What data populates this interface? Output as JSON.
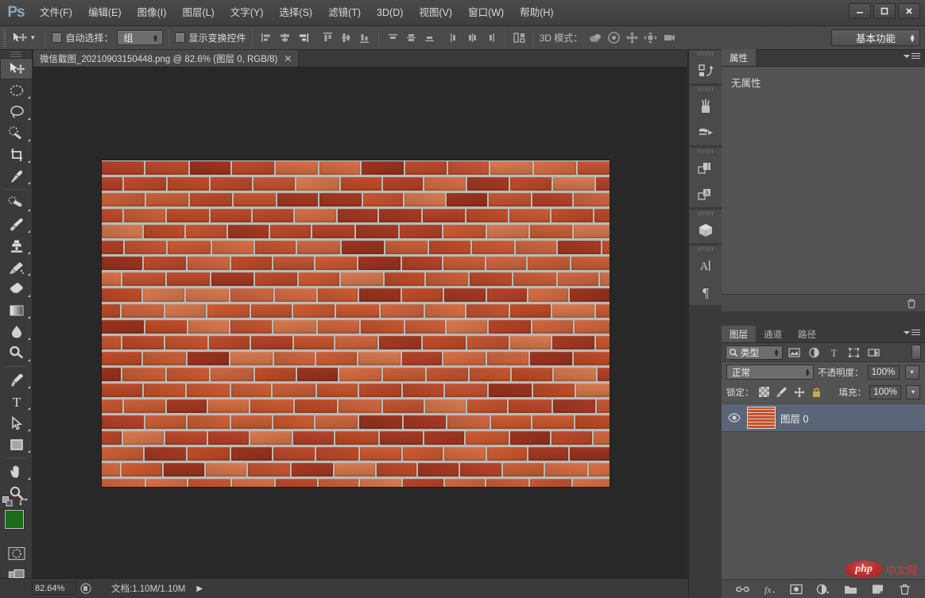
{
  "app": {
    "logo": "Ps",
    "window_controls": {
      "minimize": "—",
      "maximize": "▢",
      "close": "✕"
    }
  },
  "menubar": {
    "items": [
      {
        "label": "文件(F)",
        "name": "menu-file"
      },
      {
        "label": "编辑(E)",
        "name": "menu-edit"
      },
      {
        "label": "图像(I)",
        "name": "menu-image"
      },
      {
        "label": "图层(L)",
        "name": "menu-layer"
      },
      {
        "label": "文字(Y)",
        "name": "menu-type"
      },
      {
        "label": "选择(S)",
        "name": "menu-select"
      },
      {
        "label": "滤镜(T)",
        "name": "menu-filter"
      },
      {
        "label": "3D(D)",
        "name": "menu-3d"
      },
      {
        "label": "视图(V)",
        "name": "menu-view"
      },
      {
        "label": "窗口(W)",
        "name": "menu-window"
      },
      {
        "label": "帮助(H)",
        "name": "menu-help"
      }
    ]
  },
  "options_bar": {
    "auto_select_label": "自动选择：",
    "auto_select_value": "组",
    "show_transform_label": "显示变换控件",
    "mode_3d_label": "3D 模式：",
    "workspace": "基本功能"
  },
  "document_tab": {
    "title": "微信截图_20210903150448.png @ 82.6% (图层 0, RGB/8)",
    "close": "✕"
  },
  "toolbar": {
    "tools": [
      {
        "name": "move-tool",
        "label": "移动工具"
      },
      {
        "name": "marquee-tool",
        "label": "矩形选框工具"
      },
      {
        "name": "lasso-tool",
        "label": "套索工具"
      },
      {
        "name": "quick-selection-tool",
        "label": "快速选择工具"
      },
      {
        "name": "crop-tool",
        "label": "裁剪工具"
      },
      {
        "name": "eyedropper-tool",
        "label": "吸管工具"
      },
      {
        "name": "healing-brush-tool",
        "label": "污点修复画笔工具"
      },
      {
        "name": "brush-tool",
        "label": "画笔工具"
      },
      {
        "name": "clone-stamp-tool",
        "label": "仿制图章工具"
      },
      {
        "name": "history-brush-tool",
        "label": "历史记录画笔工具"
      },
      {
        "name": "eraser-tool",
        "label": "橡皮擦工具"
      },
      {
        "name": "gradient-tool",
        "label": "渐变工具"
      },
      {
        "name": "blur-tool",
        "label": "模糊工具"
      },
      {
        "name": "dodge-tool",
        "label": "减淡工具"
      },
      {
        "name": "pen-tool",
        "label": "钢笔工具"
      },
      {
        "name": "type-tool",
        "label": "横排文字工具"
      },
      {
        "name": "path-selection-tool",
        "label": "路径选择工具"
      },
      {
        "name": "rectangle-tool",
        "label": "矩形工具"
      },
      {
        "name": "hand-tool",
        "label": "抓手工具"
      },
      {
        "name": "zoom-tool",
        "label": "缩放工具"
      }
    ],
    "foreground_color": "#1a6b1a",
    "background_color": "#ffffff"
  },
  "status_bar": {
    "zoom": "82.64%",
    "doc_info": "文档:1.10M/1.10M",
    "arrow": "▶"
  },
  "icon_dock": {
    "items": [
      {
        "name": "history-panel-icon",
        "label": "历史记录"
      },
      {
        "name": "brush-panel-icon",
        "label": "画笔"
      },
      {
        "name": "brush-presets-panel-icon",
        "label": "画笔预设"
      },
      {
        "name": "layer-comps-panel-icon",
        "label": "图层复合"
      },
      {
        "name": "styles-panel-icon",
        "label": "样式"
      },
      {
        "name": "three-d-panel-icon",
        "label": "3D"
      },
      {
        "name": "character-panel-icon",
        "label": "字符"
      },
      {
        "name": "paragraph-panel-icon",
        "label": "段落"
      }
    ]
  },
  "properties_panel": {
    "tab": "属性",
    "body": "无属性"
  },
  "layers_panel": {
    "tabs": [
      {
        "label": "图层",
        "active": true
      },
      {
        "label": "通道",
        "active": false
      },
      {
        "label": "路径",
        "active": false
      }
    ],
    "filter_value": "类型",
    "blend_mode": "正常",
    "opacity_label": "不透明度：",
    "opacity_value": "100%",
    "lock_label": "锁定：",
    "fill_label": "填充：",
    "fill_value": "100%",
    "layers": [
      {
        "name": "图层 0",
        "visible": true,
        "selected": true
      }
    ]
  },
  "watermark": {
    "logo": "php",
    "text": "中文网"
  },
  "colors": {
    "brick_light": "#d9744a",
    "brick_mid": "#c2522f",
    "brick_dark": "#9e3c24",
    "mortar": "#bdbcb4",
    "accent_blue": "#8aa8c8",
    "selection": "#5b6577"
  }
}
